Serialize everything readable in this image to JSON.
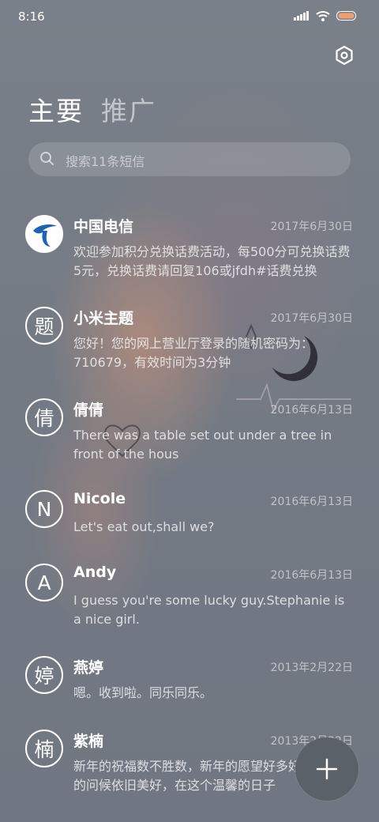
{
  "status_bar": {
    "time": "8:16"
  },
  "tabs": {
    "main": "主要",
    "promo": "推广"
  },
  "search": {
    "placeholder": "搜索11条短信"
  },
  "messages": [
    {
      "avatar": "",
      "avatar_icon": "china-telecom-logo",
      "name": "中国电信",
      "date": "2017年6月30日",
      "preview": "欢迎参加积分兑换话费活动，每500分可兑换话费5元，兑换话费请回复106或jfdh#话费兑换"
    },
    {
      "avatar": "题",
      "name": "小米主题",
      "date": "2017年6月30日",
      "preview": "您好！您的网上营业厅登录的随机密码为：710679，有效时间为3分钟"
    },
    {
      "avatar": "倩",
      "name": "倩倩",
      "date": "2016年6月13日",
      "preview": "There was a table set out under a tree in front of the hous"
    },
    {
      "avatar": "N",
      "name": "Nicole",
      "date": "2016年6月13日",
      "preview": "Let's eat out,shall we?"
    },
    {
      "avatar": "A",
      "name": "Andy",
      "date": "2016年6月13日",
      "preview": "I guess you're some lucky guy.Stephanie is a nice girl."
    },
    {
      "avatar": "婷",
      "name": "燕婷",
      "date": "2013年2月22日",
      "preview": "嗯。收到啦。同乐同乐。"
    },
    {
      "avatar": "楠",
      "name": "紫楠",
      "date": "2013年2月22日",
      "preview": "新年的祝福数不胜数，新年的愿望好多好多，新年的问候依旧美好，在这个温馨的日子"
    }
  ],
  "colors": {
    "background": "#737a84",
    "fab": "#5b6169"
  },
  "icons": {
    "settings": "hexagon-settings-icon",
    "search": "magnifier-icon",
    "compose": "plus-icon"
  }
}
